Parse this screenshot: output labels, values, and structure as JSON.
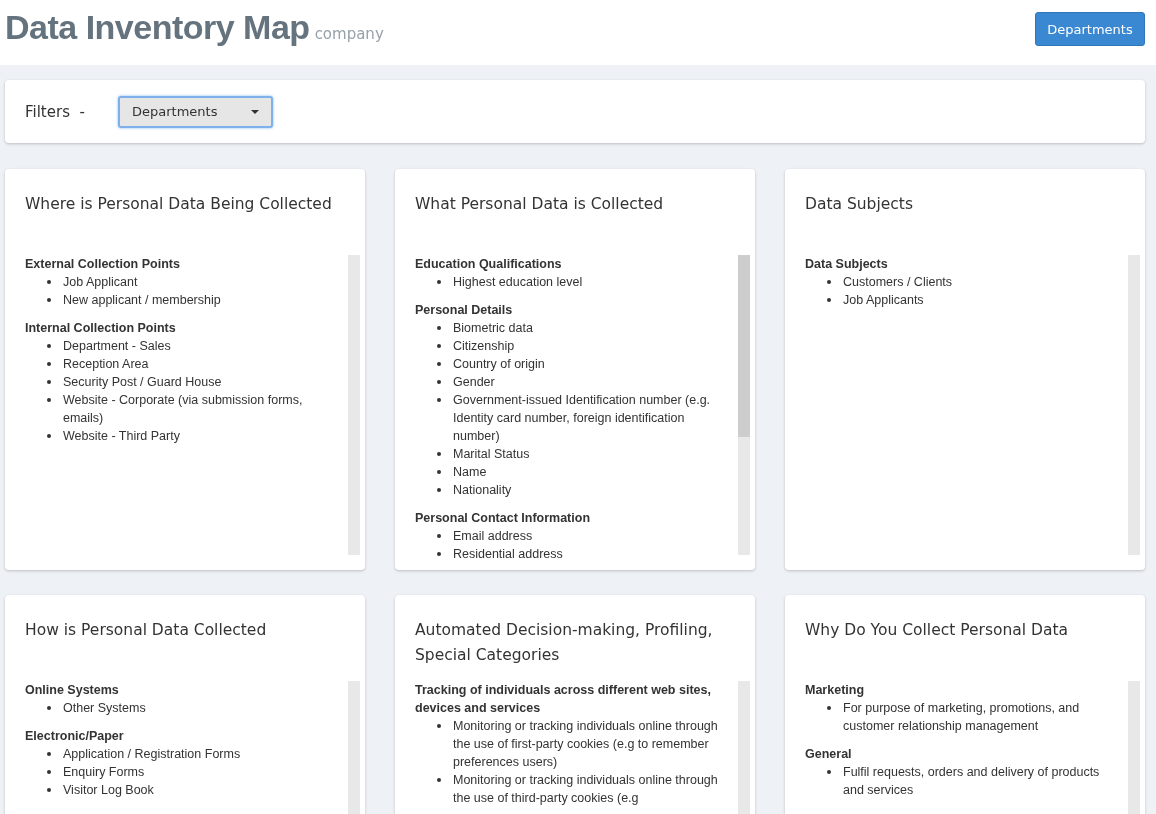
{
  "header": {
    "title": "Data Inventory Map",
    "subtitle": "company",
    "button": "Departments"
  },
  "filters": {
    "label": "Filters  -",
    "dropdown": "Departments"
  },
  "cards": [
    {
      "title": "Where is Personal Data Being Collected",
      "groups": [
        {
          "heading": "External Collection Points",
          "items": [
            "Job Applicant",
            "New applicant / membership"
          ]
        },
        {
          "heading": "Internal Collection Points",
          "items": [
            "Department - Sales",
            "Reception Area",
            "Security Post / Guard House",
            "Website - Corporate (via submission forms, emails)",
            "Website - Third Party"
          ]
        }
      ]
    },
    {
      "title": "What Personal Data is Collected",
      "groups": [
        {
          "heading": "Education Qualifications",
          "items": [
            "Highest education level"
          ]
        },
        {
          "heading": "Personal Details",
          "items": [
            "Biometric data",
            "Citizenship",
            "Country of origin",
            "Gender",
            "Government-issued Identification number (e.g. Identity card number, foreign identification number)",
            "Marital Status",
            "Name",
            "Nationality"
          ]
        },
        {
          "heading": "Personal Contact Information",
          "items": [
            "Email address",
            "Residential address"
          ]
        }
      ]
    },
    {
      "title": "Data Subjects",
      "groups": [
        {
          "heading": "Data Subjects",
          "items": [
            "Customers / Clients",
            "Job Applicants"
          ]
        }
      ]
    },
    {
      "title": "How is Personal Data Collected",
      "groups": [
        {
          "heading": "Online Systems",
          "items": [
            "Other Systems"
          ]
        },
        {
          "heading": "Electronic/Paper",
          "items": [
            "Application / Registration Forms",
            "Enquiry Forms",
            "Visitor Log Book"
          ]
        }
      ]
    },
    {
      "title": "Automated Decision-making, Profiling, Special Categories",
      "groups": [
        {
          "heading": "Tracking of individuals across different web sites, devices and services",
          "items": [
            "Monitoring or tracking individuals online through the use of first-party cookies (e.g to remember preferences users)",
            "Monitoring or tracking individuals online through the use of third-party cookies (e.g"
          ]
        }
      ]
    },
    {
      "title": "Why Do You Collect Personal Data",
      "groups": [
        {
          "heading": "Marketing",
          "items": [
            "For purpose of marketing, promotions, and customer relationship management"
          ]
        },
        {
          "heading": "General",
          "items": [
            "Fulfil requests, orders and delivery of products and services"
          ]
        }
      ]
    }
  ]
}
